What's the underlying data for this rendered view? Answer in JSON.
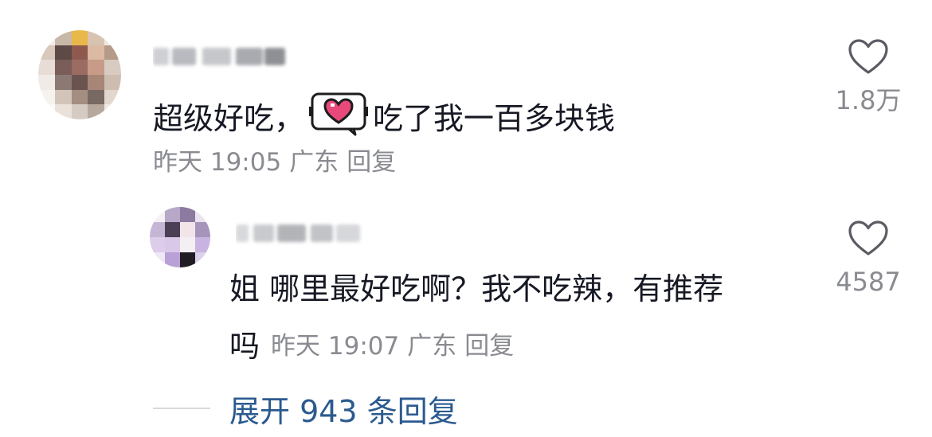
{
  "comments": [
    {
      "username": "",
      "text_before": "超级好吃，",
      "emoji": "heart-sticker",
      "text_after": "吃了我一百多块钱",
      "time": "昨天 19:05",
      "location": "广东",
      "reply_label": "回复",
      "likes": "1.8万"
    }
  ],
  "reply": {
    "username": "",
    "text_line1": "姐 哪里最好吃啊？我不吃辣，有推荐",
    "text_line2": "吗",
    "time": "昨天 19:07",
    "location": "广东",
    "reply_label": "回复",
    "likes": "4587"
  },
  "expand": {
    "label": "展开 943 条回复"
  },
  "colors": {
    "text": "#161823",
    "meta": "#8a8b91",
    "link": "#2b5a8f",
    "heart": "#e8487a"
  }
}
